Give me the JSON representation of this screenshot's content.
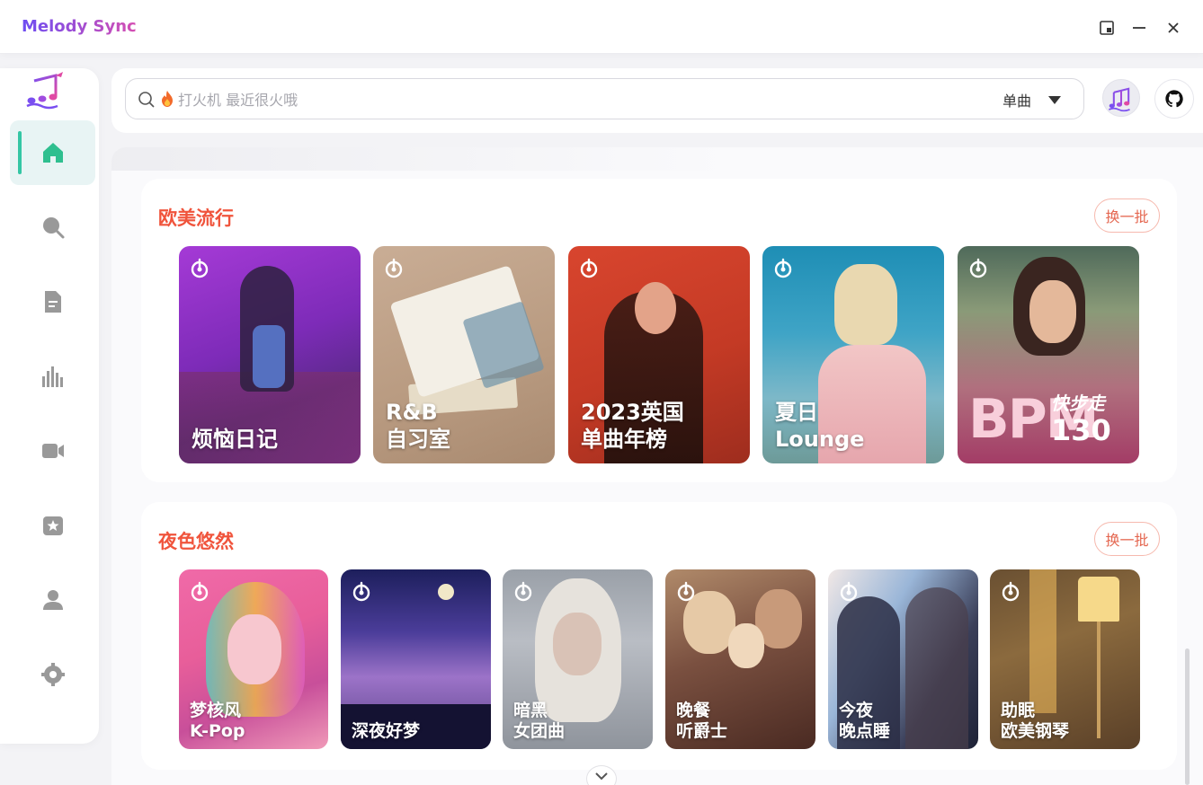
{
  "app": {
    "title": "Melody Sync"
  },
  "window_controls": [
    "pip-icon",
    "minimize-icon",
    "close-icon"
  ],
  "sidebar": {
    "items": [
      {
        "name": "home",
        "icon": "home-icon",
        "active": true
      },
      {
        "name": "search",
        "icon": "search-icon",
        "active": false
      },
      {
        "name": "document",
        "icon": "document-icon",
        "active": false
      },
      {
        "name": "charts",
        "icon": "chart-bars-icon",
        "active": false
      },
      {
        "name": "video",
        "icon": "video-icon",
        "active": false
      },
      {
        "name": "favorites",
        "icon": "star-box-icon",
        "active": false
      },
      {
        "name": "user",
        "icon": "user-icon",
        "active": false
      },
      {
        "name": "settings",
        "icon": "gear-icon",
        "active": false
      }
    ]
  },
  "search": {
    "placeholder": "打火机 最近很火哦",
    "type_selected": "单曲"
  },
  "sections": [
    {
      "title": "欧美流行",
      "refresh_label": "换一批",
      "cards": [
        {
          "lines": [
            "烦恼日记"
          ]
        },
        {
          "lines": [
            "R&B",
            "自习室"
          ]
        },
        {
          "lines": [
            "2023英国",
            "单曲年榜"
          ]
        },
        {
          "lines": [
            "夏日",
            "Lounge"
          ]
        },
        {
          "bpm_big": "BPM",
          "lines": [
            "快步走",
            "130"
          ]
        }
      ]
    },
    {
      "title": "夜色悠然",
      "refresh_label": "换一批",
      "cards": [
        {
          "lines": [
            "梦核风",
            "K-Pop"
          ]
        },
        {
          "lines": [
            "深夜好梦"
          ]
        },
        {
          "lines": [
            "暗黑",
            "女团曲"
          ]
        },
        {
          "lines": [
            "晚餐",
            "听爵士"
          ]
        },
        {
          "lines": [
            "今夜",
            "晚点睡"
          ]
        },
        {
          "lines": [
            "助眠",
            "欧美钢琴"
          ]
        }
      ]
    }
  ],
  "colors": {
    "accent_green": "#34c6a4",
    "section_title": "#f0543c",
    "brand_gradient": [
      "#6d4df2",
      "#d54fb2"
    ]
  }
}
